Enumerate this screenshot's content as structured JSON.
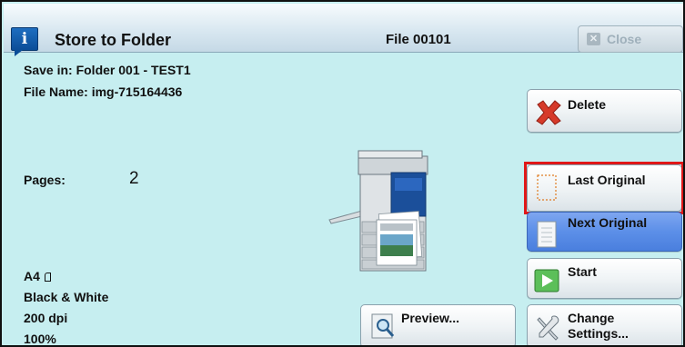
{
  "title": {
    "text": "Store to Folder",
    "icon": "info-icon",
    "icon_glyph": "i",
    "file_label": "File 00101",
    "close_label": "Close"
  },
  "info": {
    "save_in": "Save in: Folder 001 - TEST1",
    "file_name": "File Name: img-715164436",
    "pages_label": "Pages:",
    "pages_value": "2",
    "paper_size": "A4 ",
    "color_mode": "Black & White",
    "resolution": "200 dpi",
    "zoom": "100%"
  },
  "buttons": {
    "delete": "Delete",
    "last_original": "Last Original",
    "next_original": "Next Original",
    "start": "Start",
    "change_settings_line1": "Change",
    "change_settings_line2": "Settings...",
    "preview": "Preview..."
  },
  "colors": {
    "background": "#c6eef0",
    "selected": "#5c8fe8",
    "highlight": "#e01818"
  }
}
